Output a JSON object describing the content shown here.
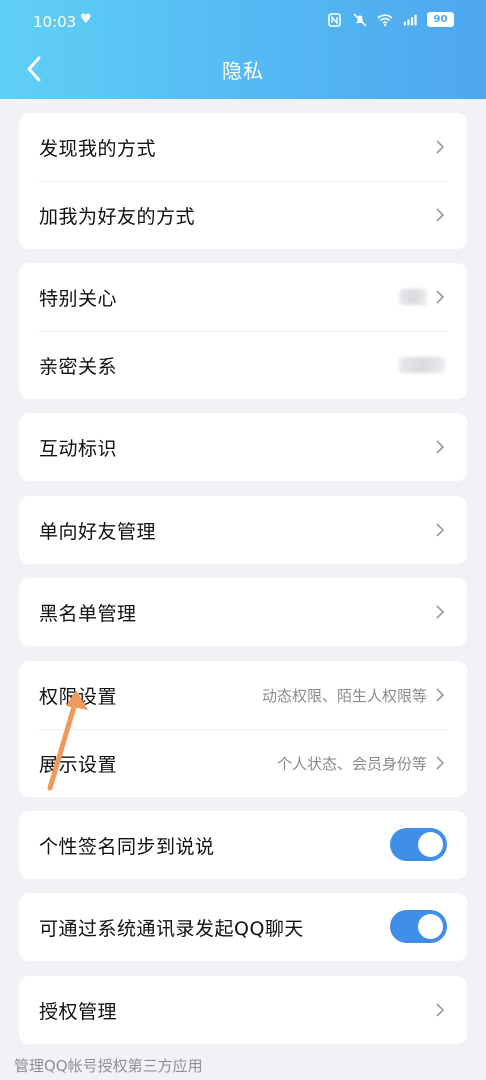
{
  "status": {
    "time": "10:03",
    "battery": "90"
  },
  "header": {
    "title": "隐私"
  },
  "groups": [
    {
      "items": [
        {
          "label": "发现我的方式"
        },
        {
          "label": "加我为好友的方式"
        }
      ]
    },
    {
      "items": [
        {
          "label": "特别关心"
        },
        {
          "label": "亲密关系"
        }
      ]
    },
    {
      "items": [
        {
          "label": "互动标识"
        }
      ]
    },
    {
      "items": [
        {
          "label": "单向好友管理"
        }
      ]
    },
    {
      "items": [
        {
          "label": "黑名单管理"
        }
      ]
    },
    {
      "items": [
        {
          "label": "权限设置",
          "value": "动态权限、陌生人权限等"
        },
        {
          "label": "展示设置",
          "value": "个人状态、会员身份等"
        }
      ]
    },
    {
      "items": [
        {
          "label": "个性签名同步到说说",
          "toggle": true
        }
      ]
    },
    {
      "items": [
        {
          "label": "可通过系统通讯录发起QQ聊天",
          "toggle": true
        }
      ]
    },
    {
      "items": [
        {
          "label": "授权管理"
        }
      ]
    }
  ],
  "footer": {
    "text": "管理QQ帐号授权第三方应用"
  },
  "colors": {
    "header_start": "#5fd0f6",
    "header_end": "#4ea7ef",
    "toggle_on": "#3f8fe9",
    "annotation_arrow": "#ef9a5c"
  },
  "icons": {
    "back": "chevron-left-icon",
    "row_arrow": "chevron-right-icon"
  }
}
